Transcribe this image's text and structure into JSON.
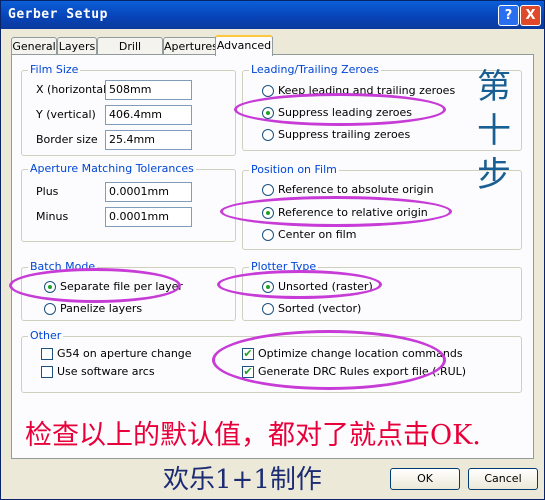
{
  "window": {
    "title": "Gerber Setup",
    "help_glyph": "?",
    "close_glyph": "X"
  },
  "tabs": [
    "General",
    "Layers",
    "Drill Drawing",
    "Apertures",
    "Advanced"
  ],
  "film_size": {
    "title": "Film Size",
    "x_label": "X (horizontal)",
    "x_value": "508mm",
    "y_label": "Y (vertical)",
    "y_value": "406.4mm",
    "border_label": "Border size",
    "border_value": "25.4mm"
  },
  "aperture": {
    "title": "Aperture Matching Tolerances",
    "plus_label": "Plus",
    "plus_value": "0.0001mm",
    "minus_label": "Minus",
    "minus_value": "0.0001mm"
  },
  "batch": {
    "title": "Batch Mode",
    "options": [
      "Separate file per layer",
      "Panelize layers"
    ],
    "selected": 0
  },
  "zeroes": {
    "title": "Leading/Trailing Zeroes",
    "options": [
      "Keep leading and trailing zeroes",
      "Suppress leading zeroes",
      "Suppress trailing zeroes"
    ],
    "selected": 1
  },
  "position": {
    "title": "Position on Film",
    "options": [
      "Reference to absolute origin",
      "Reference to relative origin",
      "Center on film"
    ],
    "selected": 1
  },
  "plotter": {
    "title": "Plotter Type",
    "options": [
      "Unsorted (raster)",
      "Sorted (vector)"
    ],
    "selected": 0
  },
  "other": {
    "title": "Other",
    "left": [
      {
        "label": "G54 on aperture change",
        "checked": false
      },
      {
        "label": "Use software arcs",
        "checked": false
      }
    ],
    "right": [
      {
        "label": "Optimize change location commands",
        "checked": true
      },
      {
        "label": "Generate DRC Rules export file (.RUL)",
        "checked": true
      }
    ]
  },
  "annotations": {
    "vertical": [
      "第",
      "十",
      "步"
    ],
    "note": "检查以上的默认值，都对了就点击OK.",
    "credit": "欢乐1+1制作"
  },
  "buttons": {
    "ok": "OK",
    "cancel": "Cancel"
  },
  "colors": {
    "title_bar": "#0842b6",
    "group_title": "#0046d5",
    "highlight": "#c73bd6",
    "note": "#e8003a"
  }
}
